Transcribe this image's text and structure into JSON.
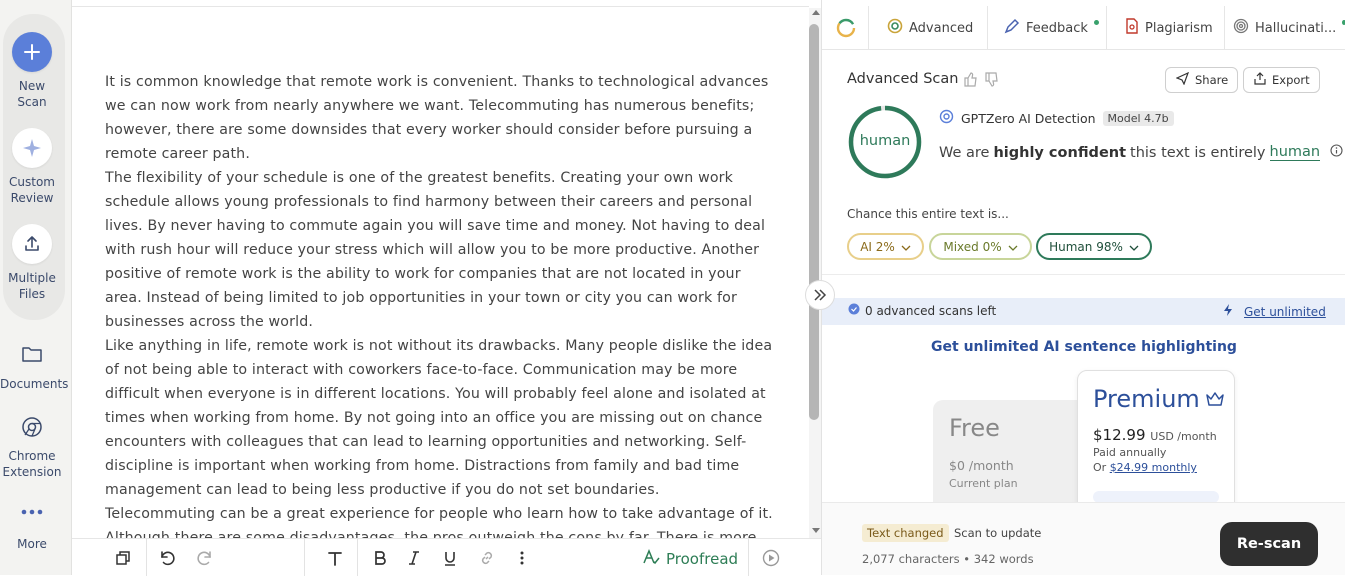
{
  "sidebar": {
    "items": [
      {
        "label": "New\nScan",
        "icon": "plus-icon"
      },
      {
        "label": "Custom\nReview",
        "icon": "sparkle-icon"
      },
      {
        "label": "Multiple\nFiles",
        "icon": "upload-icon"
      },
      {
        "label": "Documents",
        "icon": "folder-icon"
      },
      {
        "label": "Chrome\nExtension",
        "icon": "chrome-icon"
      },
      {
        "label": "More",
        "icon": "more-icon"
      }
    ]
  },
  "editor": {
    "paragraphs": [
      "It is common knowledge that remote work is convenient. Thanks to technological advances we can now work from nearly anywhere we want. Telecommuting has numerous benefits; however, there are some downsides that every worker should consider before pursuing a remote career path.",
      "The flexibility of your schedule is one of the greatest benefits. Creating your own work schedule allows young professionals to find harmony between their careers and personal lives. By never having to commute again you will save time and money. Not having to deal with rush hour will reduce your stress which will allow you to be more productive. Another positive of remote work is the ability to work for companies that are not located in your area. Instead of being limited to job opportunities in your town or city you can work for businesses across the world.",
      "Like anything in life, remote work is not without its drawbacks. Many people dislike the idea of not being able to interact with coworkers face-to-face. Communication may be more difficult when everyone is in different locations. You will probably feel alone and isolated at times when working from home. By not going into an office you are missing out on chance encounters with colleagues that can lead to learning opportunities and networking. Self-discipline is important when working from home. Distractions from family and bad time management can lead to being less productive if you do not set boundaries.",
      "Telecommuting can be a great experience for people who learn how to take advantage of it. Although there are some disadvantages, the pros outweigh the cons by far. There is more flexibility in your day-to-day schedule. Not only will you save money by never having to drive to"
    ],
    "toolbar": {
      "proofread_label": "Proofread"
    }
  },
  "panel": {
    "tabs": [
      {
        "label": "Advanced",
        "icon": "target-icon"
      },
      {
        "label": "Feedback",
        "icon": "pen-icon"
      },
      {
        "label": "Plagiarism",
        "icon": "document-icon"
      },
      {
        "label": "Hallucinati...",
        "icon": "spiral-icon"
      }
    ],
    "title": "Advanced Scan",
    "share_label": "Share",
    "export_label": "Export",
    "result": {
      "verdict": "human",
      "detector": "GPTZero AI Detection",
      "model": "Model 4.7b",
      "confidence_pre": "We are",
      "confidence_bold": "highly confident",
      "confidence_mid": "this text is entirely",
      "confidence_value": "human",
      "gauge_fraction": 0.98
    },
    "chance_label": "Chance this entire text is...",
    "pills": {
      "ai": "AI 2%",
      "mixed": "Mixed 0%",
      "human": "Human 98%"
    },
    "scans_left": "0 advanced scans left",
    "get_unlimited": "Get unlimited",
    "promo_title": "Get unlimited AI sentence highlighting",
    "free": {
      "title": "Free",
      "price": "$0",
      "period": "/month",
      "current": "Current plan"
    },
    "premium": {
      "title": "Premium",
      "price": "$12.99",
      "currency": "USD /month",
      "annual": "Paid annually",
      "or": "Or",
      "monthly": "$24.99 monthly"
    },
    "footer": {
      "changed": "Text changed",
      "scan_update": "Scan to update",
      "counts": "2,077 characters • 342 words",
      "rescan": "Re-scan"
    }
  },
  "colors": {
    "accent_green": "#2e7a5a",
    "accent_blue": "#2c4f9a",
    "new_scan_blue": "#5b7fd9"
  }
}
